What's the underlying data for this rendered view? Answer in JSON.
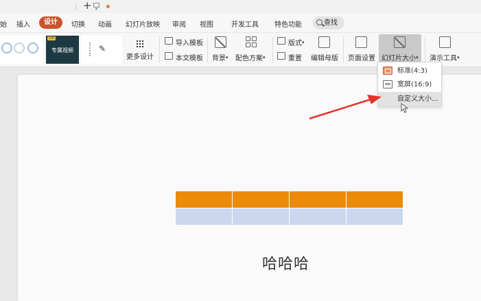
{
  "titlebar": {
    "new_tab_label": "+"
  },
  "menu": {
    "items": [
      {
        "label": "始"
      },
      {
        "label": "插入"
      },
      {
        "label": "设计"
      },
      {
        "label": "切换"
      },
      {
        "label": "动画"
      },
      {
        "label": "幻灯片放映"
      },
      {
        "label": "审阅"
      },
      {
        "label": "视图"
      },
      {
        "label": "开发工具"
      },
      {
        "label": "特色功能"
      }
    ],
    "active_index": 2,
    "search_label": "查找"
  },
  "ribbon": {
    "more_design": "更多设计",
    "import_template": "导入模板",
    "text_template": "本文模板",
    "background": "背景",
    "color_scheme": "配色方案",
    "layout": "版式",
    "reset": "重置",
    "edit_master": "编辑母版",
    "page_setup": "页面设置",
    "slide_size": "幻灯片大小",
    "presentation_tools": "演示工具",
    "theme2_caption": "专属视频"
  },
  "dropdown": {
    "items": [
      {
        "label": "标准(4:3)",
        "icon": "standard-ratio-icon"
      },
      {
        "label": "宽屏(16:9)",
        "icon": "widescreen-ratio-icon"
      },
      {
        "label": "自定义大小...",
        "icon": ""
      }
    ],
    "highlighted_index": 2
  },
  "slide": {
    "text": "哈哈哈",
    "table": {
      "rows": 2,
      "cols": 4,
      "header_color": "#ec8a0b",
      "body_color": "#cad7ee"
    }
  },
  "colors": {
    "accent": "#c9542b",
    "arrow": "#e8322c"
  }
}
